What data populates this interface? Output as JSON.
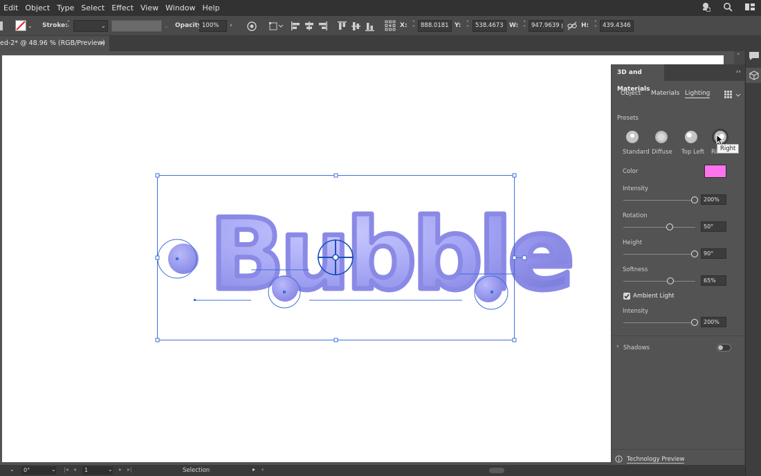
{
  "menu": [
    "Edit",
    "Object",
    "Type",
    "Select",
    "Effect",
    "View",
    "Window",
    "Help"
  ],
  "control_bar": {
    "stroke_label": "Stroke:",
    "opacity_label": "Opacity:",
    "opacity_value": "100%",
    "x_label": "X:",
    "x_value": "888.0181 px",
    "y_label": "Y:",
    "y_value": "538.4673 px",
    "w_label": "W:",
    "w_value": "947.9639 px",
    "h_label": "H:",
    "h_value": "439.4346 px"
  },
  "document_tab": {
    "title": "ed-2* @ 48.96 % (RGB/Preview)",
    "close": "×"
  },
  "panel": {
    "title": "3D and Materials",
    "tabs": [
      "Object",
      "Materials",
      "Lighting"
    ],
    "active_tab": "Lighting",
    "presets_label": "Presets",
    "presets": [
      "Standard",
      "Diffuse",
      "Top Left",
      "Ri"
    ],
    "tooltip": "Right",
    "color_label": "Color",
    "color_value": "#ff73ee",
    "intensity_label": "Intensity",
    "intensity_value": "200%",
    "rotation_label": "Rotation",
    "rotation_value": "50°",
    "height_label": "Height",
    "height_value": "90°",
    "softness_label": "Softness",
    "softness_value": "65%",
    "ambient_label": "Ambient Light",
    "ambient_checked": true,
    "ambient_intensity_label": "Intensity",
    "ambient_intensity_value": "200%",
    "shadows_label": "Shadows",
    "shadows_on": false,
    "tech_preview_label": "Technology Preview"
  },
  "artwork": {
    "text": "Bubble",
    "color": "#9c9cf0"
  },
  "status_bar": {
    "rotation": "0°",
    "artboard_num": "1",
    "tool": "Selection"
  },
  "colors": {
    "accent_selection": "#3d6fd6",
    "panel_bg": "#535353",
    "menubar_bg": "#323232"
  }
}
